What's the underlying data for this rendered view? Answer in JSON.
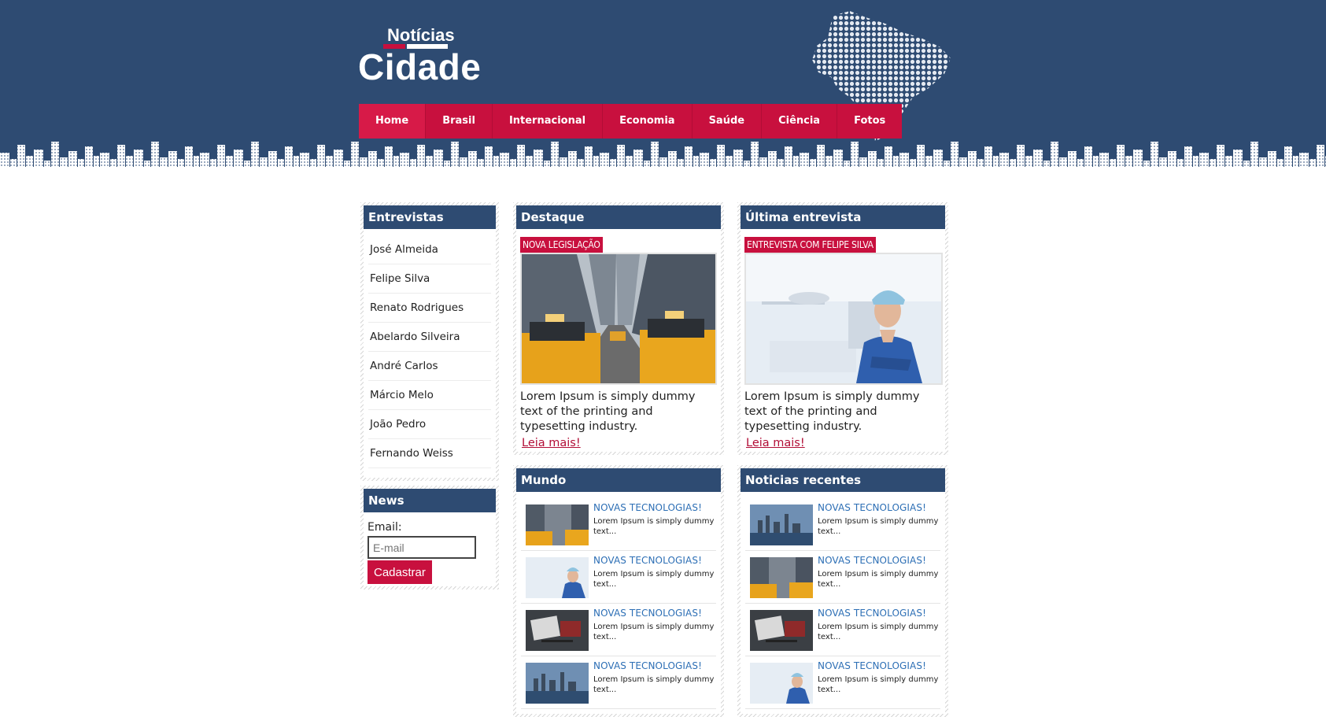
{
  "header": {
    "logo_small": "Notícias",
    "logo_big": "Cidade"
  },
  "nav": [
    {
      "label": "Home",
      "active": true
    },
    {
      "label": "Brasil"
    },
    {
      "label": "Internacional"
    },
    {
      "label": "Economia"
    },
    {
      "label": "Saúde"
    },
    {
      "label": "Ciência"
    },
    {
      "label": "Fotos"
    }
  ],
  "entrevistas": {
    "title": "Entrevistas",
    "items": [
      "José Almeida",
      "Felipe Silva",
      "Renato Rodrigues",
      "Abelardo Silveira",
      "André Carlos",
      "Márcio Melo",
      "João Pedro",
      "Fernando Weiss"
    ]
  },
  "news_form": {
    "title": "News",
    "email_label": "Email:",
    "email_placeholder": "E-mail",
    "submit_label": "Cadastrar"
  },
  "destaque": {
    "title": "Destaque",
    "tag": "NOVA LEGISLAÇÃO",
    "image": "city-taxis-photo",
    "text": "Lorem Ipsum is simply dummy text of the printing and typesetting industry.",
    "link": "Leia mais!"
  },
  "ultima": {
    "title": "Última entrevista",
    "tag": "ENTREVISTA COM FELIPE SILVA",
    "image": "doctor-photo",
    "text": "Lorem Ipsum is simply dummy text of the printing and typesetting industry.",
    "link": "Leia mais!"
  },
  "mundo": {
    "title": "Mundo",
    "items": [
      {
        "title": "NOVAS TECNOLOGIAS!",
        "desc": "Lorem Ipsum is simply dummy text...",
        "thumb": "taxi"
      },
      {
        "title": "NOVAS TECNOLOGIAS!",
        "desc": "Lorem Ipsum is simply dummy text...",
        "thumb": "doctor"
      },
      {
        "title": "NOVAS TECNOLOGIAS!",
        "desc": "Lorem Ipsum is simply dummy text...",
        "thumb": "desk"
      },
      {
        "title": "NOVAS TECNOLOGIAS!",
        "desc": "Lorem Ipsum is simply dummy text...",
        "thumb": "skyline"
      }
    ]
  },
  "recentes": {
    "title": "Noticias recentes",
    "items": [
      {
        "title": "NOVAS TECNOLOGIAS!",
        "desc": "Lorem Ipsum is simply dummy text...",
        "thumb": "skyline"
      },
      {
        "title": "NOVAS TECNOLOGIAS!",
        "desc": "Lorem Ipsum is simply dummy text...",
        "thumb": "taxi"
      },
      {
        "title": "NOVAS TECNOLOGIAS!",
        "desc": "Lorem Ipsum is simply dummy text...",
        "thumb": "desk"
      },
      {
        "title": "NOVAS TECNOLOGIAS!",
        "desc": "Lorem Ipsum is simply dummy text...",
        "thumb": "doctor"
      }
    ]
  },
  "colors": {
    "header_bg": "#2e4b72",
    "accent_red": "#c8103e",
    "link_blue": "#2d6fb5"
  }
}
